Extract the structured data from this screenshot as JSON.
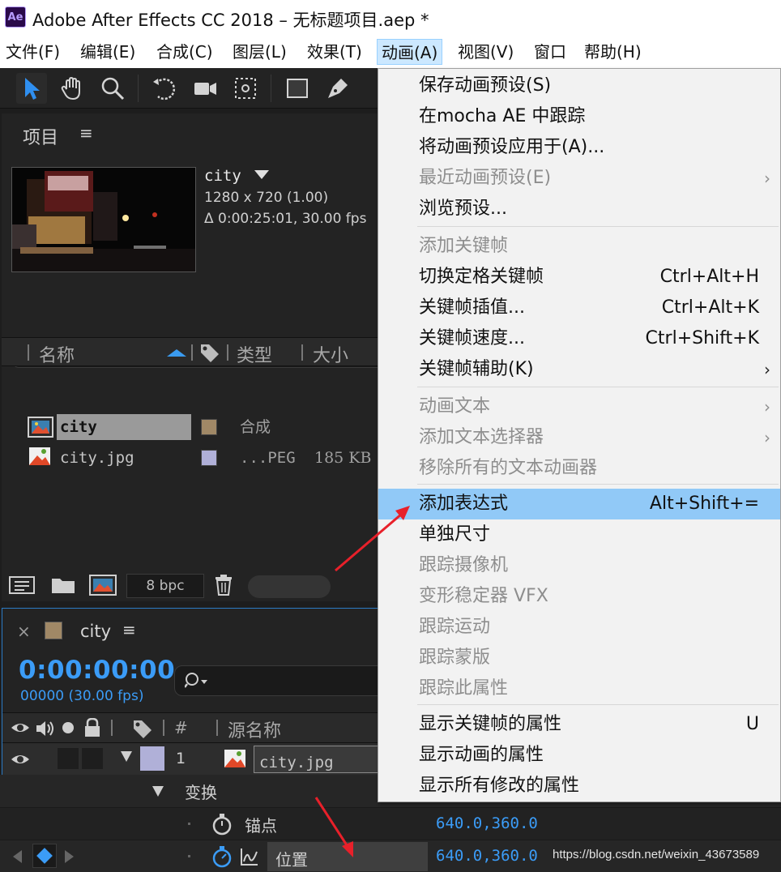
{
  "window": {
    "app_icon_text": "Ae",
    "title": "Adobe After Effects CC 2018 – 无标题项目.aep *"
  },
  "menubar": {
    "items": [
      {
        "label": "文件(F)"
      },
      {
        "label": "编辑(E)"
      },
      {
        "label": "合成(C)"
      },
      {
        "label": "图层(L)"
      },
      {
        "label": "效果(T)"
      },
      {
        "label": "动画(A)",
        "active": true
      },
      {
        "label": "视图(V)"
      },
      {
        "label": "窗口"
      },
      {
        "label": "帮助(H)"
      }
    ]
  },
  "toolbar": {
    "tools": [
      "selection-tool-icon",
      "hand-tool-icon",
      "zoom-tool-icon",
      "rotation-tool-icon",
      "camera-tool-icon",
      "pan-behind-tool-icon",
      "rectangle-tool-icon",
      "pen-tool-icon"
    ]
  },
  "project_panel": {
    "title": "项目",
    "selected_item": {
      "name": "city",
      "resolution": "1280 x 720 (1.00)",
      "duration": "Δ 0:00:25:01, 30.00 fps"
    },
    "columns": {
      "name": "名称",
      "type": "类型",
      "size": "大小"
    },
    "rows": [
      {
        "name": "city",
        "type": "合成",
        "size": "",
        "chip_color": "#a08866",
        "selected": true
      },
      {
        "name": "city.jpg",
        "type": "...PEG",
        "size": "185 KB",
        "chip_color": "#b0b0d8",
        "selected": false
      }
    ],
    "footer": {
      "bpc": "8 bpc"
    }
  },
  "timeline_panel": {
    "tab_close": "×",
    "comp_name": "city",
    "timecode": "0:00:00:00",
    "frame_fps": "00000 (30.00 fps)",
    "header": {
      "hash": "#",
      "source_name": "源名称"
    },
    "layer": {
      "index": "1",
      "name": "city.jpg",
      "chip_color": "#b0b0d8"
    },
    "transform_label": "变换",
    "properties": [
      {
        "name": "锚点",
        "value": "640.0,360.0"
      },
      {
        "name": "位置",
        "value": "640.0,360.0"
      }
    ]
  },
  "animation_menu": {
    "items": [
      {
        "label": "保存动画预设(S)",
        "shortcut": "",
        "disabled": false,
        "submenu": false
      },
      {
        "label": "在mocha AE 中跟踪",
        "shortcut": "",
        "disabled": false,
        "submenu": false
      },
      {
        "label": "将动画预设应用于(A)...",
        "shortcut": "",
        "disabled": false,
        "submenu": false
      },
      {
        "label": "最近动画预设(E)",
        "shortcut": "",
        "disabled": true,
        "submenu": true
      },
      {
        "label": "浏览预设...",
        "shortcut": "",
        "disabled": false,
        "submenu": false
      },
      {
        "label": "添加关键帧",
        "shortcut": "",
        "disabled": true,
        "submenu": false
      },
      {
        "label": "切换定格关键帧",
        "shortcut": "Ctrl+Alt+H",
        "disabled": false,
        "submenu": false
      },
      {
        "label": "关键帧插值...",
        "shortcut": "Ctrl+Alt+K",
        "disabled": false,
        "submenu": false
      },
      {
        "label": "关键帧速度...",
        "shortcut": "Ctrl+Shift+K",
        "disabled": false,
        "submenu": false
      },
      {
        "label": "关键帧辅助(K)",
        "shortcut": "",
        "disabled": false,
        "submenu": true
      },
      {
        "label": "动画文本",
        "shortcut": "",
        "disabled": true,
        "submenu": true
      },
      {
        "label": "添加文本选择器",
        "shortcut": "",
        "disabled": true,
        "submenu": true
      },
      {
        "label": "移除所有的文本动画器",
        "shortcut": "",
        "disabled": true,
        "submenu": false
      },
      {
        "label": "添加表达式",
        "shortcut": "Alt+Shift+=",
        "disabled": false,
        "submenu": false,
        "highlight": true
      },
      {
        "label": "单独尺寸",
        "shortcut": "",
        "disabled": false,
        "submenu": false
      },
      {
        "label": "跟踪摄像机",
        "shortcut": "",
        "disabled": true,
        "submenu": false
      },
      {
        "label": "变形稳定器 VFX",
        "shortcut": "",
        "disabled": true,
        "submenu": false
      },
      {
        "label": "跟踪运动",
        "shortcut": "",
        "disabled": true,
        "submenu": false
      },
      {
        "label": "跟踪蒙版",
        "shortcut": "",
        "disabled": true,
        "submenu": false
      },
      {
        "label": "跟踪此属性",
        "shortcut": "",
        "disabled": true,
        "submenu": false
      },
      {
        "label": "显示关键帧的属性",
        "shortcut": "U",
        "disabled": false,
        "submenu": false
      },
      {
        "label": "显示动画的属性",
        "shortcut": "",
        "disabled": false,
        "submenu": false
      },
      {
        "label": "显示所有修改的属性",
        "shortcut": "",
        "disabled": false,
        "submenu": false
      }
    ]
  },
  "colors": {
    "accent_blue": "#3b9cf7",
    "menu_highlight": "#91c9f7",
    "annotation_red": "#e8202a"
  },
  "watermark": "https://blog.csdn.net/weixin_43673589"
}
